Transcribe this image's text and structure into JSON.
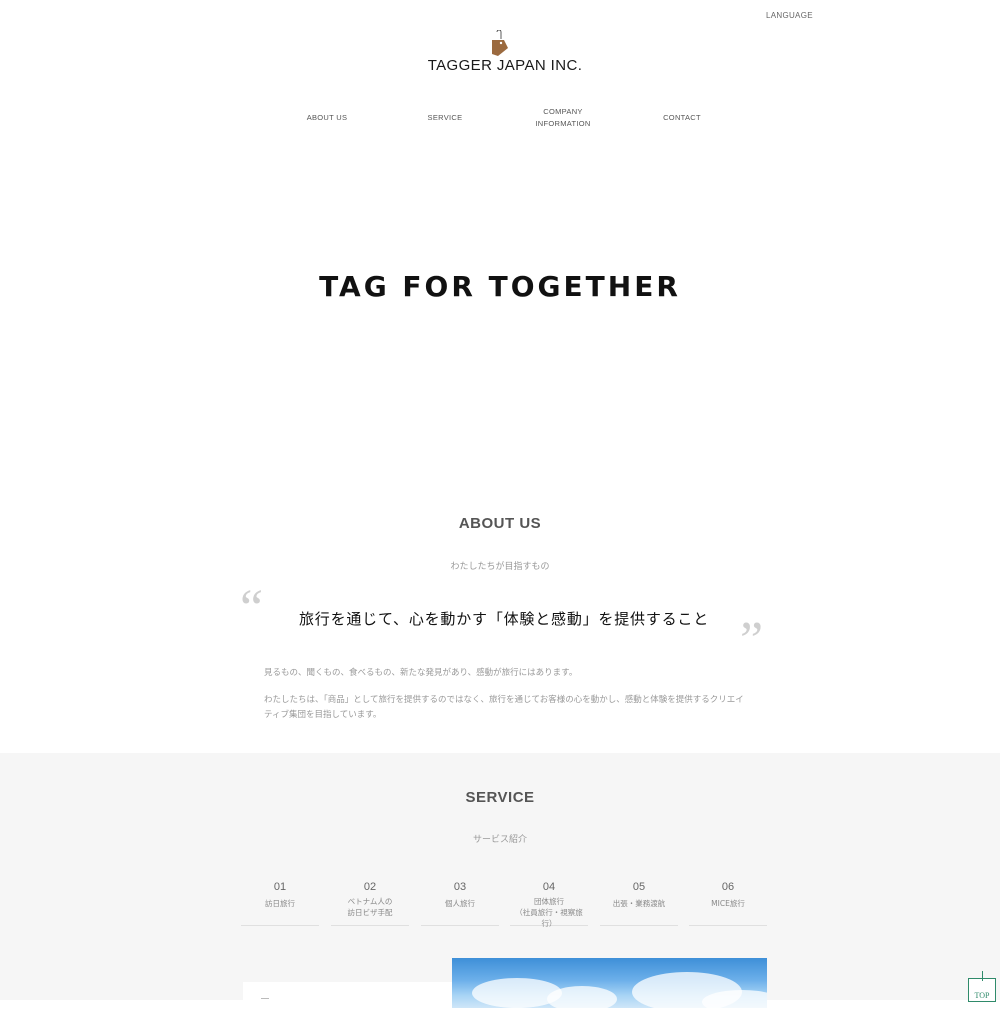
{
  "header": {
    "language_label": "LANGUAGE",
    "logo_text": "TAGGER JAPAN INC."
  },
  "nav": {
    "about": "ABOUT US",
    "service": "SERVICE",
    "company_line1": "COMPANY",
    "company_line2": "INFORMATION",
    "contact": "CONTACT"
  },
  "hero": {
    "tagline": "TAG FOR TOGETHER"
  },
  "about": {
    "title": "ABOUT US",
    "subtitle": "わたしたちが目指すもの",
    "catchphrase": "旅行を通じて、心を動かす「体験と感動」を提供すること",
    "paragraph1": "見るもの、聞くもの、食べるもの、新たな発見があり、感動が旅行にはあります。",
    "paragraph2": "わたしたちは、「商品」として旅行を提供するのではなく、旅行を通じてお客様の心を動かし、感動と体験を提供するクリエイティブ集団を目指しています。"
  },
  "service": {
    "title": "SERVICE",
    "subtitle": "サービス紹介",
    "items": [
      {
        "num": "01",
        "line1": "訪日旅行",
        "line2": ""
      },
      {
        "num": "02",
        "line1": "ベトナム人の",
        "line2": "訪日ビザ手配"
      },
      {
        "num": "03",
        "line1": "個人旅行",
        "line2": ""
      },
      {
        "num": "04",
        "line1": "団体旅行",
        "line2": "（社員旅行・視察旅行）"
      },
      {
        "num": "05",
        "line1": "出張・業務渡航",
        "line2": ""
      },
      {
        "num": "06",
        "line1": "MICE旅行",
        "line2": ""
      }
    ]
  },
  "page_top": {
    "label": "TOP"
  },
  "colors": {
    "logo_tag": "#9b6a3f",
    "accent_green": "#2f8a6a",
    "service_bg": "#f6f6f6"
  },
  "icons": {
    "logo": "tag-icon"
  }
}
